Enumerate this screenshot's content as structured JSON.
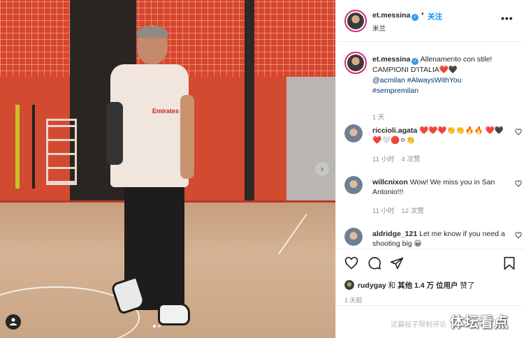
{
  "post": {
    "author": "et.messina",
    "follow_label": "关注",
    "separator": "•",
    "location": "米兰",
    "more_label": "•••"
  },
  "caption": {
    "author": "et.messina",
    "text_line1": "Allenamento con stile!",
    "text_line2": "CAMPIONI D'ITALIA❤️🖤",
    "tag1": "@acmilan",
    "tag2": "#AlwaysWithYou",
    "tag3": "#sempremilan",
    "time": "1 天"
  },
  "comments": [
    {
      "user": "riccioli.agata",
      "text": "❤️❤️❤️👏👏🔥🔥 ❤️🖤❤️🤍🔴⚪👏",
      "time": "11 小时",
      "likes": "4 次赞"
    },
    {
      "user": "willcnixon",
      "text": "Wow! We miss you in San Antonio!!!",
      "time": "11 小时",
      "likes": "12 次赞"
    },
    {
      "user": "aldridge_121",
      "text": "Let me know if you need a shooting big 😀"
    }
  ],
  "likes": {
    "user": "rudygay",
    "connector": "和",
    "others": "其他 1.4 万 位用户",
    "suffix": "赞了"
  },
  "post_age": "1 天前",
  "comment_limit_text": "这篇帖子限制评论",
  "watermark": "体坛看点",
  "photo": {
    "shirt_text": "Emirates"
  },
  "icons": {
    "verified": "verified-badge-icon",
    "heart": "heart-icon",
    "comment": "comment-icon",
    "share": "share-icon",
    "save": "bookmark-icon",
    "next": "chevron-right-icon",
    "user_tag": "user-tag-icon"
  },
  "colors": {
    "accent_blue": "#0095f6",
    "tag_blue": "#00376b",
    "muted_gray": "#8e8e8e"
  }
}
